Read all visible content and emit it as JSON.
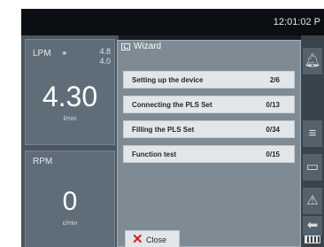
{
  "status_bar": {
    "time": "12:01:02 P"
  },
  "lpm": {
    "label": "LPM",
    "link_icon": "chain-link-icon",
    "range_high": "4.8",
    "range_low": "4.0",
    "value": "4.30",
    "unit": "l/min"
  },
  "rpm": {
    "label": "RPM",
    "value": "0",
    "unit": "c/min"
  },
  "wizard": {
    "icon": "wizard-icon",
    "title": "Wizard",
    "steps": [
      {
        "label": "Setting up the device",
        "count": "2/6"
      },
      {
        "label": "Connecting the PLS Set",
        "count": "0/13"
      },
      {
        "label": "Filling the PLS Set",
        "count": "0/34"
      },
      {
        "label": "Function test",
        "count": "0/15"
      }
    ],
    "close_label": "Close"
  },
  "right_bar": {
    "icons": [
      "bell-icon",
      "menu-icon",
      "wizard-book-icon",
      "warning-icon",
      "power-plug-icon",
      "battery-icon"
    ]
  }
}
